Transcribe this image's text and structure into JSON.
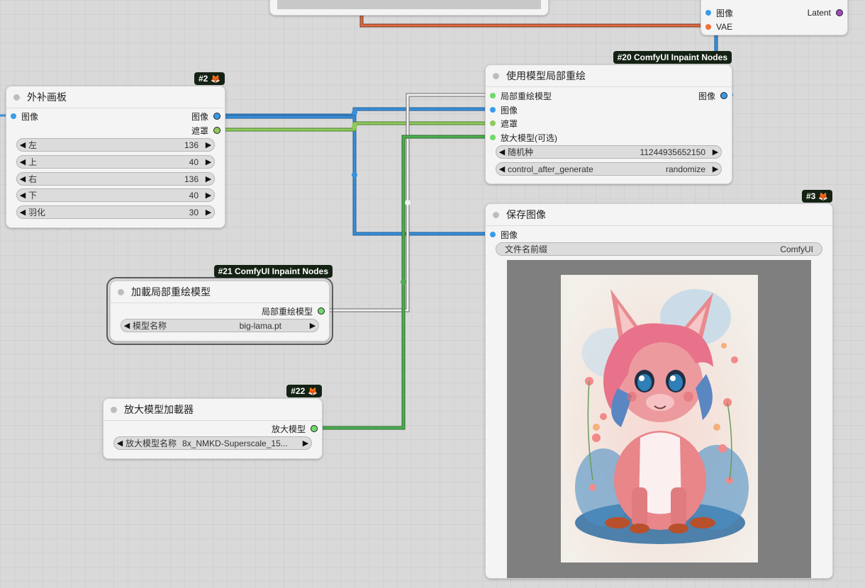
{
  "colors": {
    "image_wire": "#3a8fd8",
    "mask_wire": "#7fbf5a",
    "upscale_wire": "#4caf50",
    "model_wire": "#e8e8e8",
    "vae_wire": "#e4683f",
    "badge_bg": "#142214"
  },
  "top_node": {
    "inputs": [
      "图像",
      "VAE"
    ],
    "output": "Latent"
  },
  "outpaint_node": {
    "badge": "#2",
    "title": "外补画板",
    "input": "图像",
    "outputs": [
      "图像",
      "遮罩"
    ],
    "widgets": [
      {
        "label": "左",
        "value": "136"
      },
      {
        "label": "上",
        "value": "40"
      },
      {
        "label": "右",
        "value": "136"
      },
      {
        "label": "下",
        "value": "40"
      },
      {
        "label": "羽化",
        "value": "30"
      }
    ]
  },
  "inpaint_node": {
    "badge": "#20 ComfyUI Inpaint Nodes",
    "title": "使用模型局部重绘",
    "inputs": [
      "局部重绘模型",
      "图像",
      "遮罩",
      "放大模型(可选)"
    ],
    "output": "图像",
    "widgets": [
      {
        "label": "随机种",
        "value": "11244935652150"
      },
      {
        "label": "control_after_generate",
        "value": "randomize"
      }
    ]
  },
  "load_inpaint_node": {
    "badge": "#21 ComfyUI Inpaint Nodes",
    "title": "加載局部重绘模型",
    "output": "局部重绘模型",
    "widget": {
      "label": "模型名称",
      "value": "big-lama.pt"
    }
  },
  "upscale_loader_node": {
    "badge": "#22",
    "title": "放大模型加載器",
    "output": "放大模型",
    "widget": {
      "label": "放大模型名称",
      "value": "8x_NMKD-Superscale_15..."
    }
  },
  "save_node": {
    "badge": "#3",
    "title": "保存图像",
    "input": "图像",
    "widget": {
      "label": "文件名前缀",
      "value": "ComfyUI"
    }
  }
}
